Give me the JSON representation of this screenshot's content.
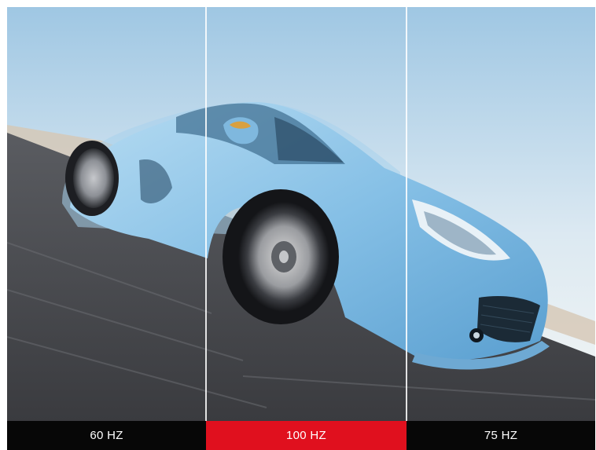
{
  "panels": [
    {
      "label": "60 HZ",
      "highlight": false
    },
    {
      "label": "100 HZ",
      "highlight": true
    },
    {
      "label": "75 HZ",
      "highlight": false
    }
  ],
  "colors": {
    "highlight": "#e0101e",
    "label_bg": "#070707",
    "car_body": "#8fc6e8",
    "sky_top": "#a9cde6",
    "road": "#4a4b50"
  }
}
